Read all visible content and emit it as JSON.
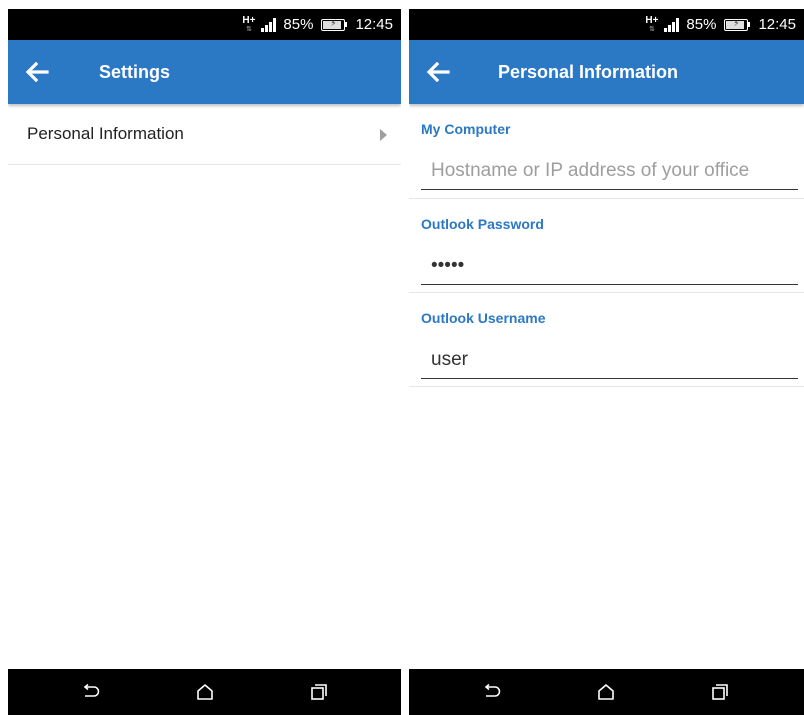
{
  "status_bar": {
    "network": "H+",
    "battery_percent": "85%",
    "time": "12:45"
  },
  "settings_screen": {
    "title": "Settings",
    "items": [
      {
        "label": "Personal Information"
      }
    ]
  },
  "personal_info_screen": {
    "title": "Personal Information",
    "fields": [
      {
        "label": "My Computer",
        "value": "",
        "placeholder": "Hostname or IP address of your office"
      },
      {
        "label": "Outlook Password",
        "value": "*****",
        "placeholder": ""
      },
      {
        "label": "Outlook Username",
        "value": "user",
        "placeholder": ""
      }
    ]
  },
  "nav_bar": {
    "buttons": [
      "back-icon",
      "home-icon",
      "recents-icon"
    ]
  },
  "colors": {
    "accent": "#2b78c5",
    "status_bar": "#000000",
    "nav_bar": "#000000"
  }
}
